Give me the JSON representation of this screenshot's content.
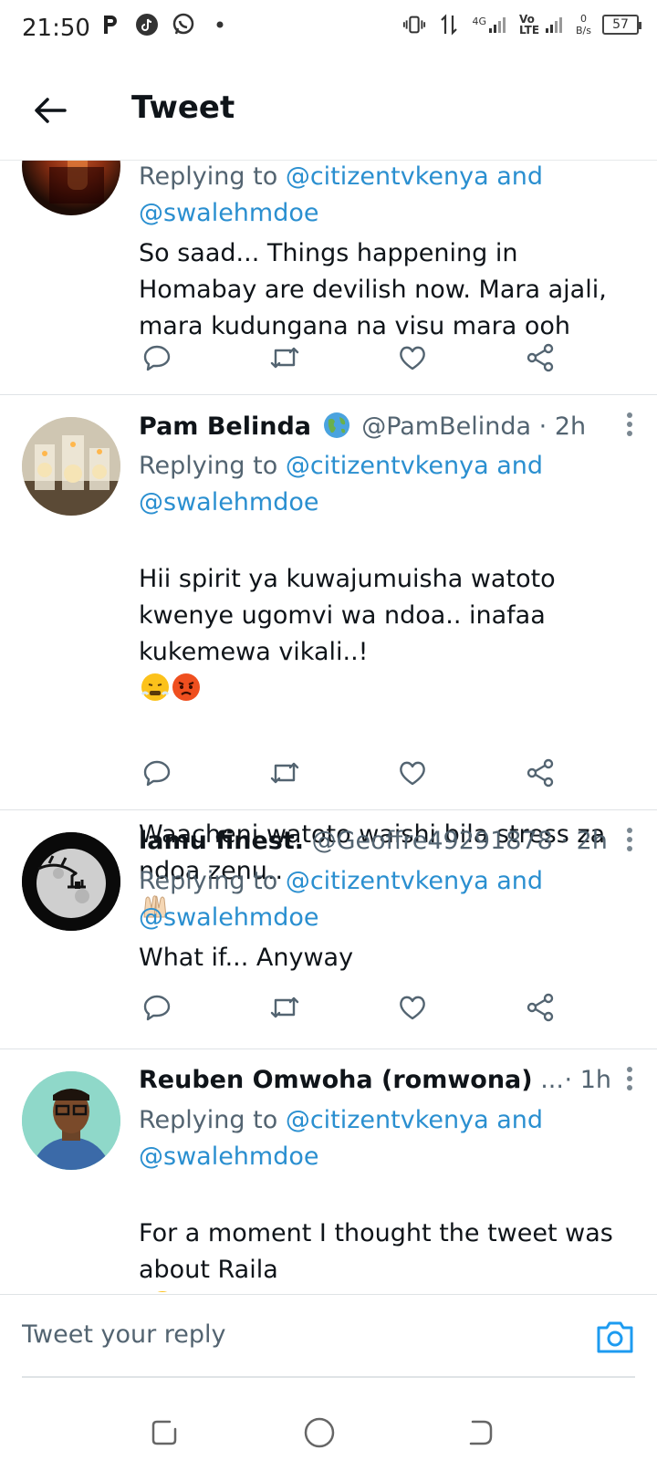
{
  "status_bar": {
    "time": "21:50",
    "net_4g": "4G",
    "volte": "Vo LTE",
    "speed_value": "0",
    "speed_unit": "B/s",
    "battery": "57"
  },
  "header": {
    "title": "Tweet"
  },
  "colors": {
    "accent": "#1d9bf0",
    "text_primary": "#0f1419",
    "text_secondary": "#536471"
  },
  "tweets": [
    {
      "name": "",
      "handle": "",
      "time": "",
      "reply_prefix": "Replying to",
      "reply_to_1": "@citizentvkenya",
      "reply_and": "and",
      "reply_to_2": "@swalehmdoe",
      "text": "So saad... Things happening in Homabay are devilish now. Mara ajali, mara kudungana na visu mara ooh"
    },
    {
      "name": "Pam Belinda",
      "handle": "@PamBelinda",
      "time": "2h",
      "reply_prefix": "Replying to",
      "reply_to_1": "@citizentvkenya",
      "reply_and": "and",
      "reply_to_2": "@swalehmdoe",
      "text_line1": "Hii spirit ya kuwajumuisha watoto kwenye ugomvi wa ndoa.. inafaa kukemewa vikali..!",
      "text_line2": "Waacheni watoto waishi bila stress za ndoa zenu.."
    },
    {
      "name": "lamu finest.",
      "handle": "@Geoffre49291878",
      "time": "2h",
      "reply_prefix": "Replying to",
      "reply_to_1": "@citizentvkenya",
      "reply_and": "and",
      "reply_to_2": "@swalehmdoe",
      "text": "What if... Anyway"
    },
    {
      "name": "Reuben Omwoha (romwona)",
      "name_ellipsis": "...",
      "time": "1h",
      "reply_prefix": "Replying to",
      "reply_to_1": "@citizentvkenya",
      "reply_and": "and",
      "reply_to_2": "@swalehmdoe",
      "text": "For a moment I thought the tweet was about Raila"
    }
  ],
  "composer": {
    "placeholder": "Tweet your reply"
  },
  "icons": {
    "reply": "reply-icon",
    "retweet": "retweet-icon",
    "like": "heart-icon",
    "share": "share-icon",
    "camera": "camera-icon",
    "back": "arrow-left-icon"
  }
}
